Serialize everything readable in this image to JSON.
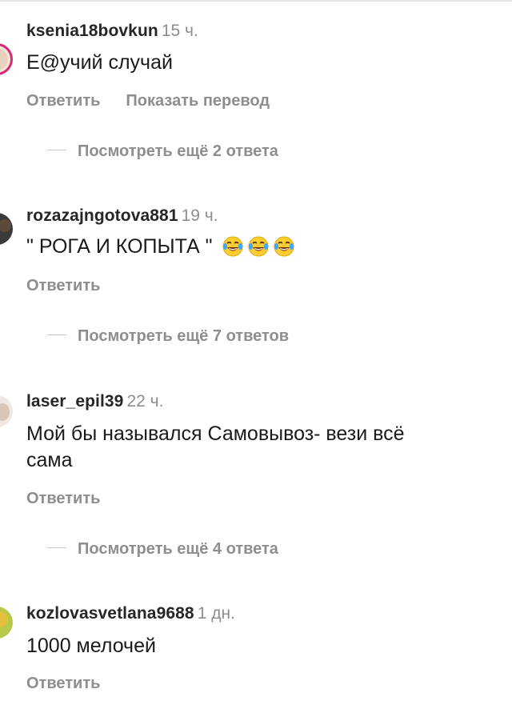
{
  "comments": [
    {
      "username": "ksenia18bovkun",
      "time": "15 ч.",
      "text": "Е@учий случай",
      "reply_label": "Ответить",
      "translate_label": "Показать перевод",
      "view_replies": "Посмотреть ещё 2 ответа"
    },
    {
      "username": "rozazajngotova881",
      "time": "19 ч.",
      "text": "\" РОГА И КОПЫТА \"",
      "emoji": "face-with-tears-of-joy-icon",
      "reply_label": "Ответить",
      "view_replies": "Посмотреть ещё 7 ответов"
    },
    {
      "username": "laser_epil39",
      "time": "22 ч.",
      "text_line1": "Мой бы назывался Самовывоз- вези всё",
      "text_line2": "сама",
      "reply_label": "Ответить",
      "view_replies": "Посмотреть ещё 4 ответа"
    },
    {
      "username": "kozlovasvetlana9688",
      "time": "1 дн.",
      "text": "1000 мелочей",
      "reply_label": "Ответить"
    }
  ],
  "colors": {
    "username": "#262626",
    "secondary": "#8e8e8e",
    "story_ring": "#d62976",
    "divider": "#c7c7c7"
  }
}
